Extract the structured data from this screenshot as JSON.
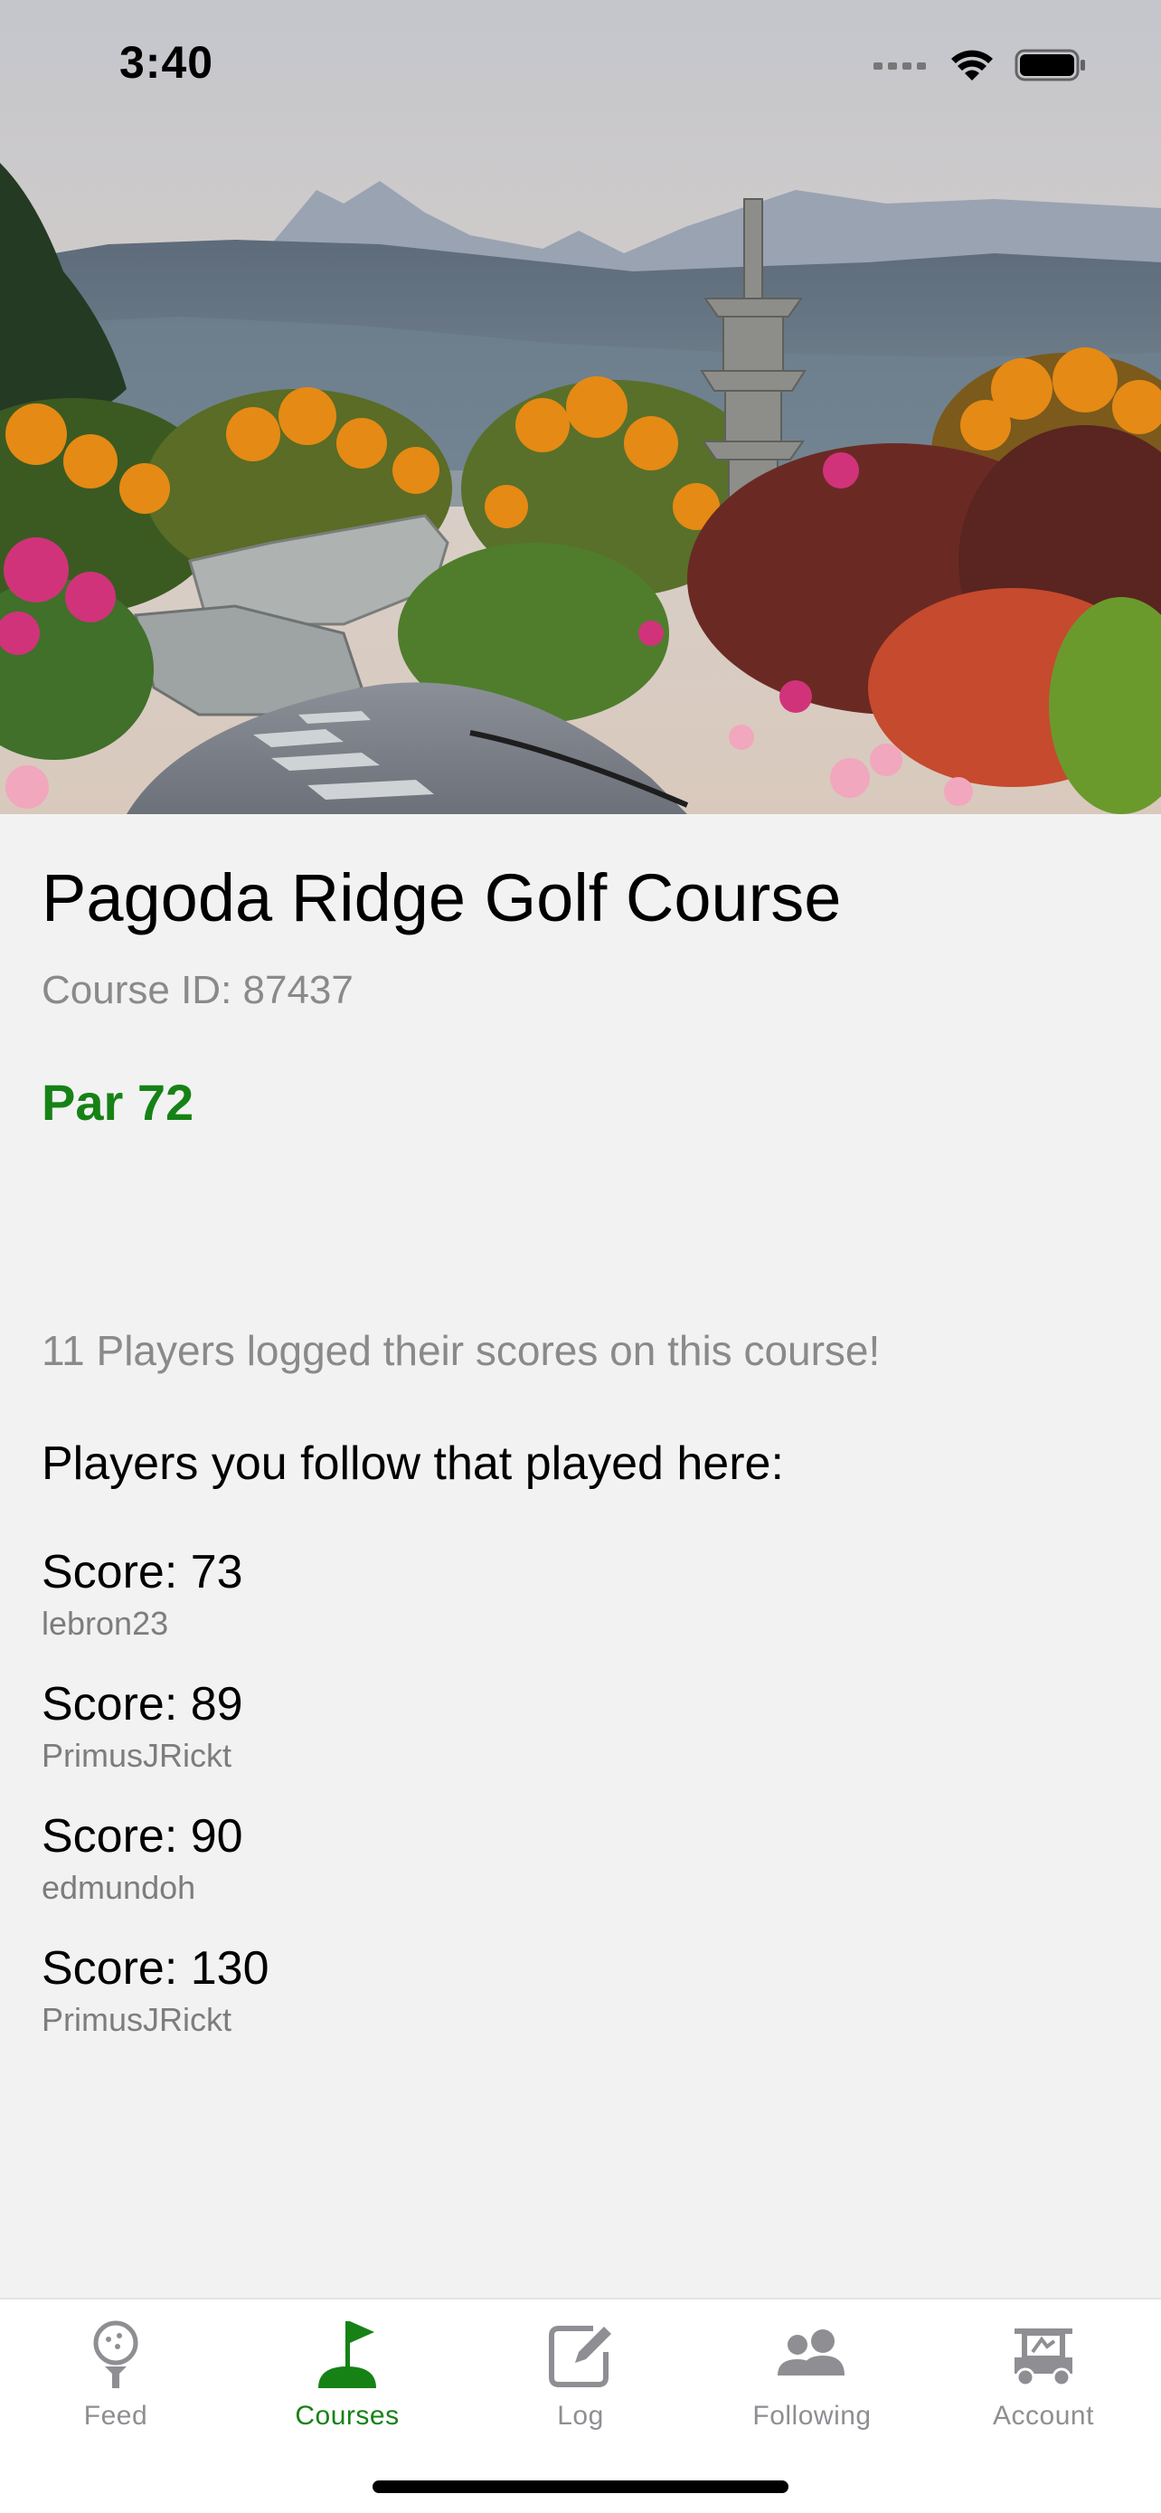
{
  "status_bar": {
    "time": "3:40",
    "icons": [
      "cellular-signal-icon",
      "wifi-icon",
      "battery-icon"
    ]
  },
  "hero": {
    "image_description_icon": "course-photo"
  },
  "course": {
    "name": "Pagoda Ridge Golf Course",
    "id_text": "Course ID: 87437",
    "par_text": "Par 72"
  },
  "players_logged_text": "11 Players logged their scores on this course!",
  "following_heading": "Players you follow that played here:",
  "scores": [
    {
      "score": "Score: 73",
      "user": "lebron23"
    },
    {
      "score": "Score: 89",
      "user": "PrimusJRickt"
    },
    {
      "score": "Score: 90",
      "user": "edmundoh"
    },
    {
      "score": "Score: 130",
      "user": "PrimusJRickt"
    }
  ],
  "tab_bar": {
    "tabs": [
      {
        "label": "Feed",
        "icon": "golf-ball-tee-icon",
        "active": false
      },
      {
        "label": "Courses",
        "icon": "golf-flag-icon",
        "active": true
      },
      {
        "label": "Log",
        "icon": "edit-square-icon",
        "active": false
      },
      {
        "label": "Following",
        "icon": "people-icon",
        "active": false
      },
      {
        "label": "Account",
        "icon": "golf-cart-icon",
        "active": false
      }
    ]
  },
  "colors": {
    "accent": "#168216",
    "inactive_tab": "#8e8e93",
    "secondary_text": "#8a8a8a",
    "background": "#f2f2f2"
  }
}
